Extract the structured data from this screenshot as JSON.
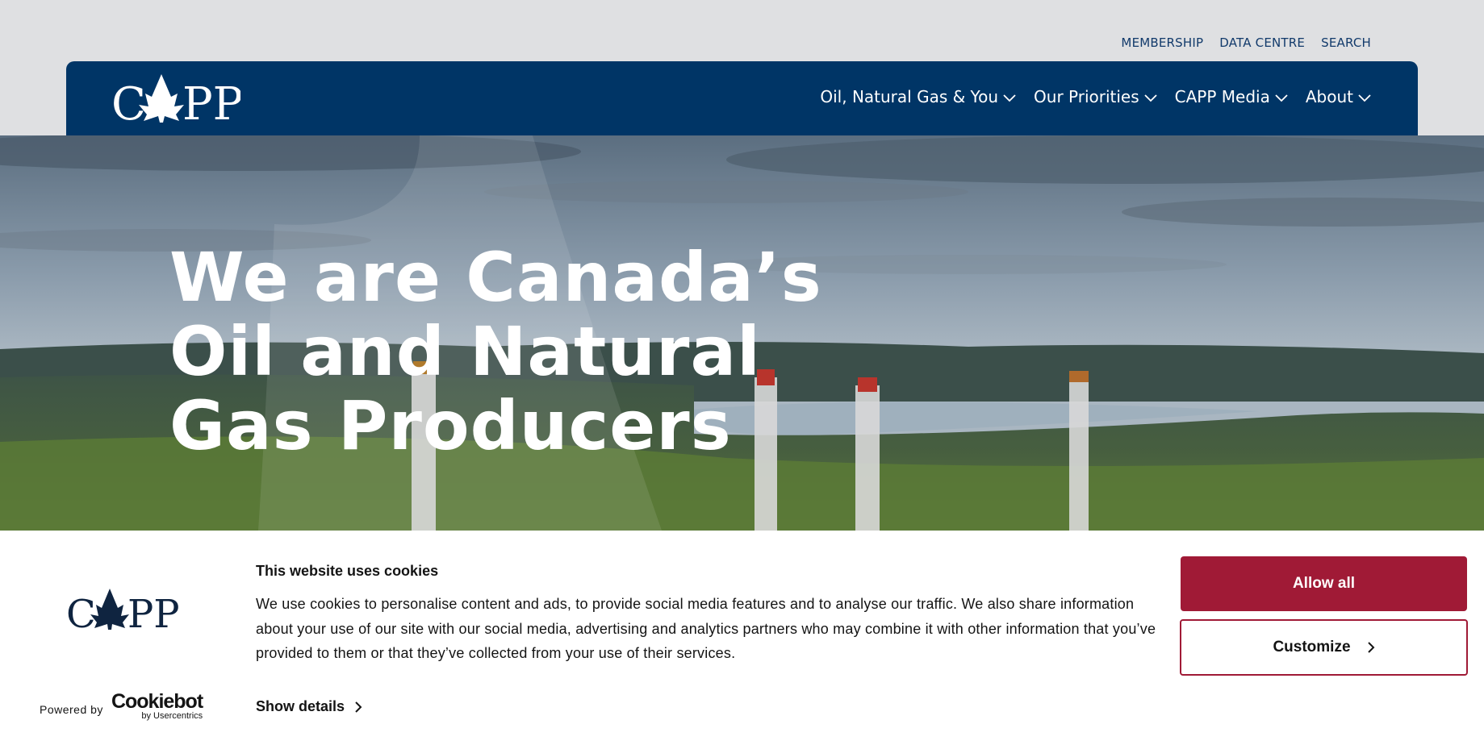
{
  "utility_nav": {
    "membership": "MEMBERSHIP",
    "data_centre": "DATA CENTRE",
    "search": "SEARCH"
  },
  "brand": {
    "logo_text_left": "C",
    "logo_text_right": "PP",
    "nav_color": "#003566"
  },
  "main_nav": {
    "items": [
      {
        "label": "Oil, Natural Gas & You"
      },
      {
        "label": "Our Priorities"
      },
      {
        "label": "CAPP Media"
      },
      {
        "label": "About"
      }
    ]
  },
  "hero": {
    "title_lines": [
      "We are Canada’s",
      "Oil and Natural",
      "Gas Producers"
    ]
  },
  "cookie_banner": {
    "title": "This website uses cookies",
    "body": "We use cookies to personalise content and ads, to provide social media features and to analyse our traffic. We also share information about your use of our site with our social media, advertising and analytics partners who may combine it with other information that you’ve provided to them or that they’ve collected from your use of their services.",
    "show_details": "Show details",
    "allow_all": "Allow all",
    "customize": "Customize",
    "powered_by": "Powered by",
    "cookiebot": "Cookiebot",
    "cookiebot_by": "by Usercentrics",
    "accent_color": "#a01a36"
  }
}
